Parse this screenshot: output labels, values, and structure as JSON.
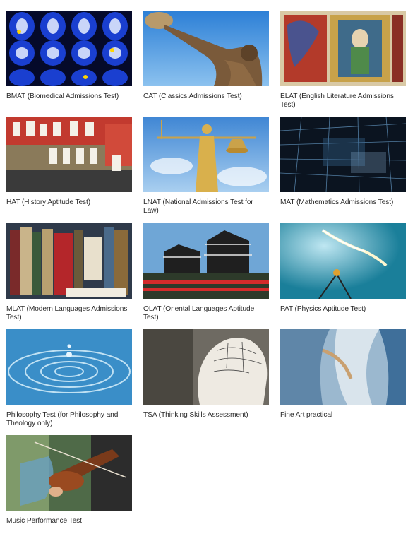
{
  "tests": [
    {
      "label": "BMAT (Biomedical Admissions Test)",
      "image": "brain-scan-image"
    },
    {
      "label": "CAT (Classics Admissions Test)",
      "image": "discus-thrower-statue-image"
    },
    {
      "label": "ELAT (English Literature Admissions Test)",
      "image": "illuminated-manuscript-image"
    },
    {
      "label": "HAT (History Aptitude Test)",
      "image": "berlin-wall-graffiti-image"
    },
    {
      "label": "LNAT (National Admissions Test for Law)",
      "image": "lady-justice-statue-image"
    },
    {
      "label": "MAT (Mathematics Admissions Test)",
      "image": "abstract-grid-image"
    },
    {
      "label": "MLAT (Modern Languages Admissions Test)",
      "image": "bookshelf-image"
    },
    {
      "label": "OLAT (Oriental Languages Aptitude Test)",
      "image": "japanese-castle-image"
    },
    {
      "label": "PAT (Physics Aptitude Test)",
      "image": "light-bulb-filament-image"
    },
    {
      "label": "Philosophy Test (for Philosophy and Theology only)",
      "image": "water-droplet-ripple-image"
    },
    {
      "label": "TSA (Thinking Skills Assessment)",
      "image": "phrenology-head-image"
    },
    {
      "label": "Fine Art practical",
      "image": "abstract-paint-image"
    },
    {
      "label": "Music Performance Test",
      "image": "violinist-image"
    }
  ]
}
